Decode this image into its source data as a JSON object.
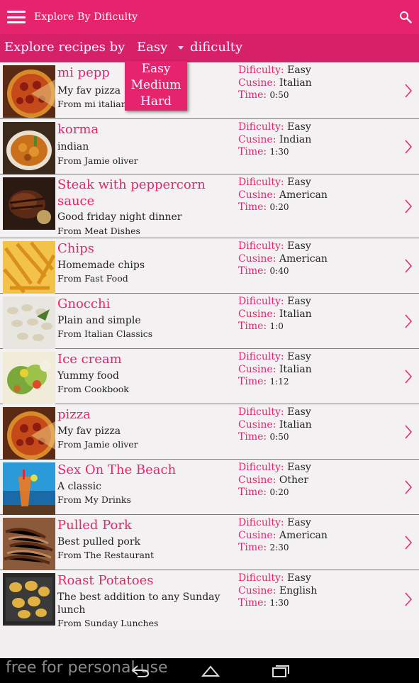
{
  "appbar": {
    "title": "Explore By Dificulty"
  },
  "filter": {
    "prefix": "Explore recipes by",
    "selected": "Easy",
    "suffix": "dificulty"
  },
  "dropdown": {
    "options": [
      "Easy",
      "Medium",
      "Hard"
    ]
  },
  "labels": {
    "difficulty": "Dificulty:",
    "cuisine": "Cusine:",
    "time": "Time:"
  },
  "recipes": [
    {
      "name": "mi pepp",
      "desc": "My fav pizza",
      "from": "From mi italian",
      "difficulty": "Easy",
      "cuisine": "Italian",
      "time": "0:50",
      "thumb": "pizza"
    },
    {
      "name": "korma",
      "desc": "indian",
      "from": "From Jamie oliver",
      "difficulty": "Easy",
      "cuisine": "Indian",
      "time": "1:30",
      "thumb": "curry"
    },
    {
      "name": "Steak with peppercorn sauce",
      "desc": "Good friday night dinner",
      "from": "From Meat Dishes",
      "difficulty": "Easy",
      "cuisine": "American",
      "time": "0:20",
      "thumb": "steak"
    },
    {
      "name": "Chips",
      "desc": "Homemade chips",
      "from": "From Fast Food",
      "difficulty": "Easy",
      "cuisine": "American",
      "time": "0:40",
      "thumb": "chips"
    },
    {
      "name": "Gnocchi",
      "desc": "Plain and simple",
      "from": "From Italian Classics",
      "difficulty": "Easy",
      "cuisine": "Italian",
      "time": "1:0",
      "thumb": "gnocchi"
    },
    {
      "name": "Ice cream",
      "desc": "Yummy food",
      "from": "From Cookbook",
      "difficulty": "Easy",
      "cuisine": "Italian",
      "time": "1:12",
      "thumb": "salad"
    },
    {
      "name": "pizza",
      "desc": "My fav pizza",
      "from": "From Jamie oliver",
      "difficulty": "Easy",
      "cuisine": "Italian",
      "time": "0:50",
      "thumb": "pizza"
    },
    {
      "name": "Sex On The Beach",
      "desc": "A classic",
      "from": "From My Drinks",
      "difficulty": "Easy",
      "cuisine": "Other",
      "time": "0:20",
      "thumb": "drink"
    },
    {
      "name": "Pulled Pork",
      "desc": "Best pulled pork",
      "from": "From The Restaurant",
      "difficulty": "Easy",
      "cuisine": "American",
      "time": "2:30",
      "thumb": "pork"
    },
    {
      "name": "Roast Potatoes",
      "desc": "The best addition to any Sunday lunch",
      "from": "From Sunday Lunches",
      "difficulty": "Easy",
      "cuisine": "English",
      "time": "1:30",
      "thumb": "potatoes"
    }
  ],
  "watermark": "free for personal use",
  "colors": {
    "accent": "#e6246e",
    "accent_dark": "#d62067",
    "row_bg": "#f3f1f2"
  }
}
